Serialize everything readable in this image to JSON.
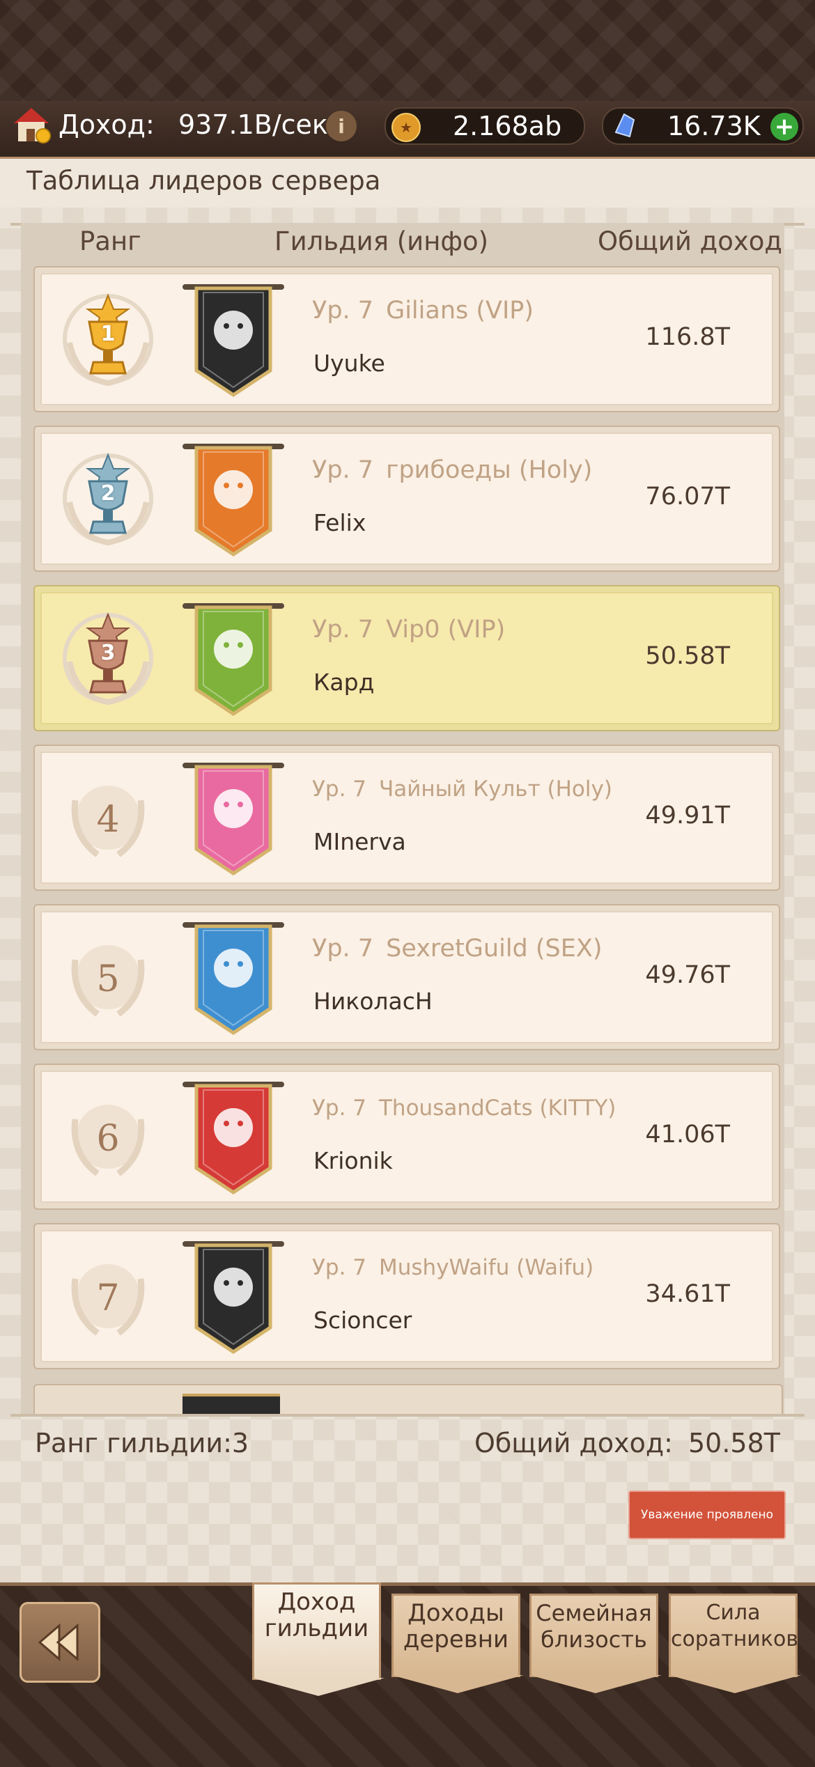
{
  "resources": {
    "income_label": "Доход:",
    "income_value": "937.1B/сек",
    "coins": "2.168ab",
    "gems": "16.73K"
  },
  "title": "Таблица лидеров сервера",
  "headers": {
    "rank": "Ранг",
    "guild": "Гильдия (инфо)",
    "income": "Общий доход"
  },
  "rows": [
    {
      "rank": "1",
      "level": "Ур. 7",
      "guild": "Gilians (VIP)",
      "leader": "Uyuke",
      "income": "116.8T",
      "banner_color": "#2b2b2b",
      "highlight": false
    },
    {
      "rank": "2",
      "level": "Ур. 7",
      "guild": "грибоеды (Holy)",
      "leader": "Felix",
      "income": "76.07T",
      "banner_color": "#e57a2a",
      "highlight": false
    },
    {
      "rank": "3",
      "level": "Ур. 7",
      "guild": "Vip0 (VIP)",
      "leader": "Кард",
      "income": "50.58T",
      "banner_color": "#7fb23a",
      "highlight": true
    },
    {
      "rank": "4",
      "level": "Ур. 7",
      "guild": "Чайный Культ (Holy)",
      "leader": "MInerva",
      "income": "49.91T",
      "banner_color": "#e96aa0",
      "highlight": false
    },
    {
      "rank": "5",
      "level": "Ур. 7",
      "guild": "SexretGuild (SEX)",
      "leader": "НиколасН",
      "income": "49.76T",
      "banner_color": "#3e8fd0",
      "highlight": false
    },
    {
      "rank": "6",
      "level": "Ур. 7",
      "guild": "ThousandCats (KITTY)",
      "leader": "Krionik",
      "income": "41.06T",
      "banner_color": "#d63a36",
      "highlight": false
    },
    {
      "rank": "7",
      "level": "Ур. 7",
      "guild": "MushyWaifu (Waifu)",
      "leader": "Scioncer",
      "income": "34.61T",
      "banner_color": "#2b2b2b",
      "highlight": false
    }
  ],
  "footer": {
    "guild_rank": "Ранг гильдии:3",
    "total_income_label": "Общий доход:",
    "total_income_value": "50.58T",
    "respect_button": "Уважение проявлено"
  },
  "tabs": [
    {
      "line1": "Доход",
      "line2": "гильдии",
      "active": true
    },
    {
      "line1": "Доходы",
      "line2": "деревни",
      "active": false
    },
    {
      "line1": "Семейная",
      "line2": "близость",
      "active": false
    },
    {
      "line1": "Сила",
      "line2": "соратников",
      "active": false
    }
  ]
}
